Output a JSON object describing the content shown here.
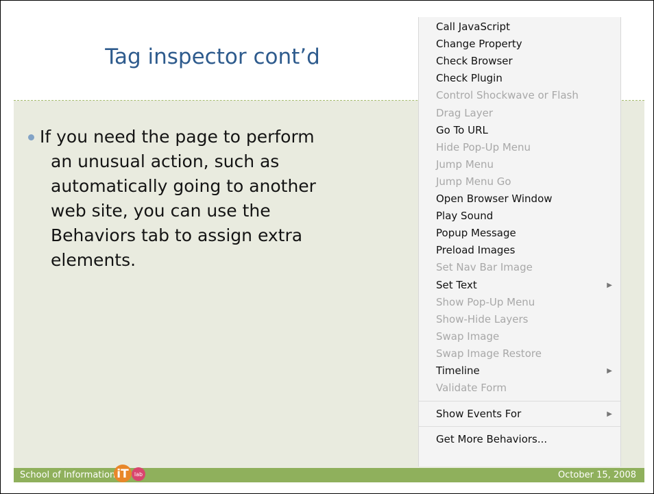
{
  "slide": {
    "title": "Tag inspector cont’d",
    "bullet_lines": [
      "If you need the page to perform",
      "an unusual action, such as",
      "automatically going to another",
      "web site, you can use the",
      "Behaviors tab to assign extra",
      "elements."
    ]
  },
  "footer": {
    "left_text": "School of Information",
    "right_text": "October 15, 2008",
    "logo_text": "iT",
    "logo_badge": "lab",
    "logo_icon": "itlab-logo"
  },
  "menu": {
    "items": [
      {
        "label": "Call JavaScript",
        "enabled": true
      },
      {
        "label": "Change Property",
        "enabled": true
      },
      {
        "label": "Check Browser",
        "enabled": true
      },
      {
        "label": "Check Plugin",
        "enabled": true
      },
      {
        "label": "Control Shockwave or Flash",
        "enabled": false
      },
      {
        "label": "Drag Layer",
        "enabled": false
      },
      {
        "label": "Go To URL",
        "enabled": true
      },
      {
        "label": "Hide Pop-Up Menu",
        "enabled": false
      },
      {
        "label": "Jump Menu",
        "enabled": false
      },
      {
        "label": "Jump Menu Go",
        "enabled": false
      },
      {
        "label": "Open Browser Window",
        "enabled": true
      },
      {
        "label": "Play Sound",
        "enabled": true
      },
      {
        "label": "Popup Message",
        "enabled": true
      },
      {
        "label": "Preload Images",
        "enabled": true
      },
      {
        "label": "Set Nav Bar Image",
        "enabled": false
      },
      {
        "label": "Set Text",
        "enabled": true,
        "submenu": true
      },
      {
        "label": "Show Pop-Up Menu",
        "enabled": false
      },
      {
        "label": "Show-Hide Layers",
        "enabled": false
      },
      {
        "label": "Swap Image",
        "enabled": false
      },
      {
        "label": "Swap Image Restore",
        "enabled": false
      },
      {
        "label": "Timeline",
        "enabled": true,
        "submenu": true
      },
      {
        "label": "Validate Form",
        "enabled": false
      },
      {
        "label": "Show Events For",
        "enabled": true,
        "submenu": true
      },
      {
        "label": "Get More Behaviors...",
        "enabled": true
      }
    ],
    "submenu_arrow": "▶"
  },
  "colors": {
    "title": "#2e5b8d",
    "footer_bar": "#8fb05c",
    "slide_bg": "#e9ebdf",
    "bullet_dot": "#82a3c6",
    "disabled_text": "#a8a8a8"
  }
}
